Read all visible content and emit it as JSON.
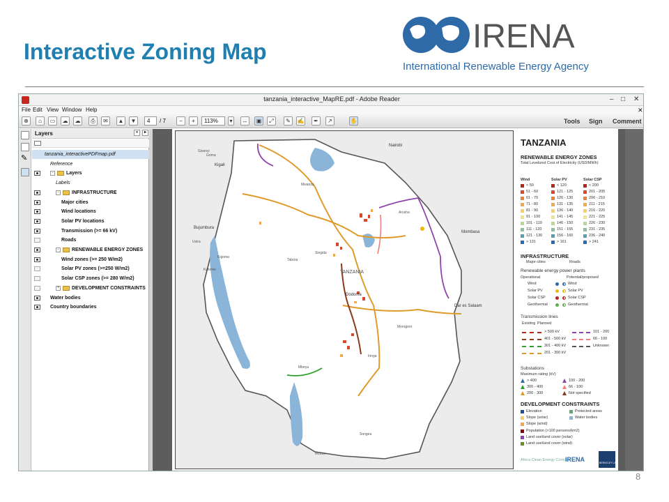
{
  "slide": {
    "title": "Interactive Zoning Map",
    "page_number": "8",
    "logo": {
      "wordmark": "IRENA",
      "tagline": "International Renewable Energy Agency"
    }
  },
  "reader": {
    "window_title": "tanzania_interactive_MapRE.pdf - Adobe Reader",
    "menu": [
      "File",
      "Edit",
      "View",
      "Window",
      "Help"
    ],
    "toolbar": {
      "page_current": "4",
      "page_total": "/ 7",
      "zoom": "113%",
      "links": [
        "Tools",
        "Sign",
        "Comment"
      ]
    },
    "layers_panel": {
      "title": "Layers",
      "items": [
        {
          "label": "tanzania_interactivePDFmap.pdf",
          "indent": 0,
          "style": "italic",
          "eye": "none",
          "selected": true
        },
        {
          "label": "Reference",
          "indent": 1,
          "style": "italic",
          "eye": "none"
        },
        {
          "label": "Layers",
          "indent": 1,
          "style": "bold",
          "eye": "on",
          "folder": true,
          "tree": "-"
        },
        {
          "label": "Labels",
          "indent": 2,
          "style": "italic",
          "eye": "none"
        },
        {
          "label": "INFRASTRUCTURE",
          "indent": 2,
          "style": "bold",
          "eye": "on",
          "folder": true,
          "tree": "-"
        },
        {
          "label": "Major cities",
          "indent": 3,
          "style": "bold",
          "eye": "on"
        },
        {
          "label": "Wind locations",
          "indent": 3,
          "style": "bold",
          "eye": "on"
        },
        {
          "label": "Solar PV locations",
          "indent": 3,
          "style": "bold",
          "eye": "on"
        },
        {
          "label": "Transmission (>= 66 kV)",
          "indent": 3,
          "style": "bold",
          "eye": "on"
        },
        {
          "label": "Roads",
          "indent": 3,
          "style": "bold",
          "eye": "off"
        },
        {
          "label": "RENEWABLE ENERGY ZONES",
          "indent": 2,
          "style": "bold",
          "eye": "on",
          "folder": true,
          "tree": "-"
        },
        {
          "label": "Wind zones (>= 250 W/m2)",
          "indent": 3,
          "style": "bold",
          "eye": "on"
        },
        {
          "label": "Solar PV zones (>=250 W/m2)",
          "indent": 3,
          "style": "bold",
          "eye": "off"
        },
        {
          "label": "Solar CSP zones (>= 280 W/m2)",
          "indent": 3,
          "style": "bold",
          "eye": "off"
        },
        {
          "label": "DEVELOPMENT CONSTRAINTS",
          "indent": 2,
          "style": "bold",
          "eye": "off",
          "folder": true,
          "tree": "+"
        },
        {
          "label": "Water bodies",
          "indent": 1,
          "style": "bold",
          "eye": "on"
        },
        {
          "label": "Country boundaries",
          "indent": 1,
          "style": "bold",
          "eye": "on"
        }
      ]
    }
  },
  "map": {
    "place_labels": [
      "Nairobi",
      "Mombasa",
      "Kigali",
      "Bujumbura",
      "Dodoma",
      "Dar es Salaam",
      "TANZANIA",
      "Gisenyi",
      "Goma",
      "Uvira",
      "Kalemie",
      "Mzuzu",
      "Songea",
      "Tabora",
      "Arusha",
      "Mwanza",
      "Morogoro",
      "Iringa",
      "Mbeya",
      "Kigoma",
      "Singida"
    ],
    "legend": {
      "country": "TANZANIA",
      "zones_title": "RENEWABLE ENERGY ZONES",
      "zones_subtitle": "Total Levelized Cost of Electricity (USD/MWh)",
      "columns": [
        "Wind",
        "Solar PV",
        "Solar CSP"
      ],
      "wind": [
        "< 50",
        "51 - 60",
        "61 - 70",
        "71 - 80",
        "81 - 90",
        "91 - 100",
        "101 - 110",
        "111 - 120",
        "121 - 130",
        "> 131"
      ],
      "solar_pv": [
        "< 120",
        "121 - 125",
        "126 - 130",
        "131 - 135",
        "136 - 140",
        "141 - 145",
        "146 - 150",
        "151 - 155",
        "156 - 160",
        "> 161"
      ],
      "solar_csp": [
        "< 200",
        "201 - 205",
        "206 - 210",
        "211 - 215",
        "216 - 220",
        "221 - 225",
        "226 - 230",
        "231 - 235",
        "236 - 240",
        "> 241"
      ],
      "scale_colors": [
        "#b3261e",
        "#d9482b",
        "#e8823a",
        "#efaa4e",
        "#f2d06b",
        "#e7e58f",
        "#bcd69a",
        "#8dbfa0",
        "#5a9fb3",
        "#2b6cae"
      ],
      "infrastructure_title": "INFRASTRUCTURE",
      "major_cities": "Major cities",
      "roads": "Roads",
      "plants_title": "Renewable energy power plants",
      "operational": "Operational",
      "potential": "Potential/proposed",
      "plant_types": [
        "Wind",
        "Solar PV",
        "Solar CSP",
        "Geothermal"
      ],
      "lines_title": "Transmission lines",
      "existing": "Existing",
      "planned": "Planned",
      "lines_left": [
        "> 500 kV",
        "401 - 500 kV",
        "301 - 400 kV",
        "201 - 300 kV"
      ],
      "lines_right": [
        "101 - 200",
        "66 - 100",
        "Unknown"
      ],
      "substations_title": "Substations",
      "substations_sub": "Maximum rating (kV)",
      "substations": [
        "> 400",
        "100 - 200",
        "300 - 400",
        "66 - 100",
        "200 - 300",
        "Not specified"
      ],
      "constraints_title": "DEVELOPMENT CONSTRAINTS",
      "constraints": [
        "Elevation",
        "Protected areas",
        "Slope (solar)",
        "Water bodies",
        "Slope (wind)",
        "Population (>100 persons/km2)",
        "Land use\\land cover (solar)",
        "Land use\\land cover (wind)"
      ],
      "footer_logos": [
        "Africa Clean Energy Corridor",
        "IRENA",
        "BERKELEY LAB"
      ]
    }
  },
  "colors": {
    "title_blue": "#1f7fb0",
    "reader_bg": "#5d5d5d",
    "selection": "#cfe0f3"
  }
}
